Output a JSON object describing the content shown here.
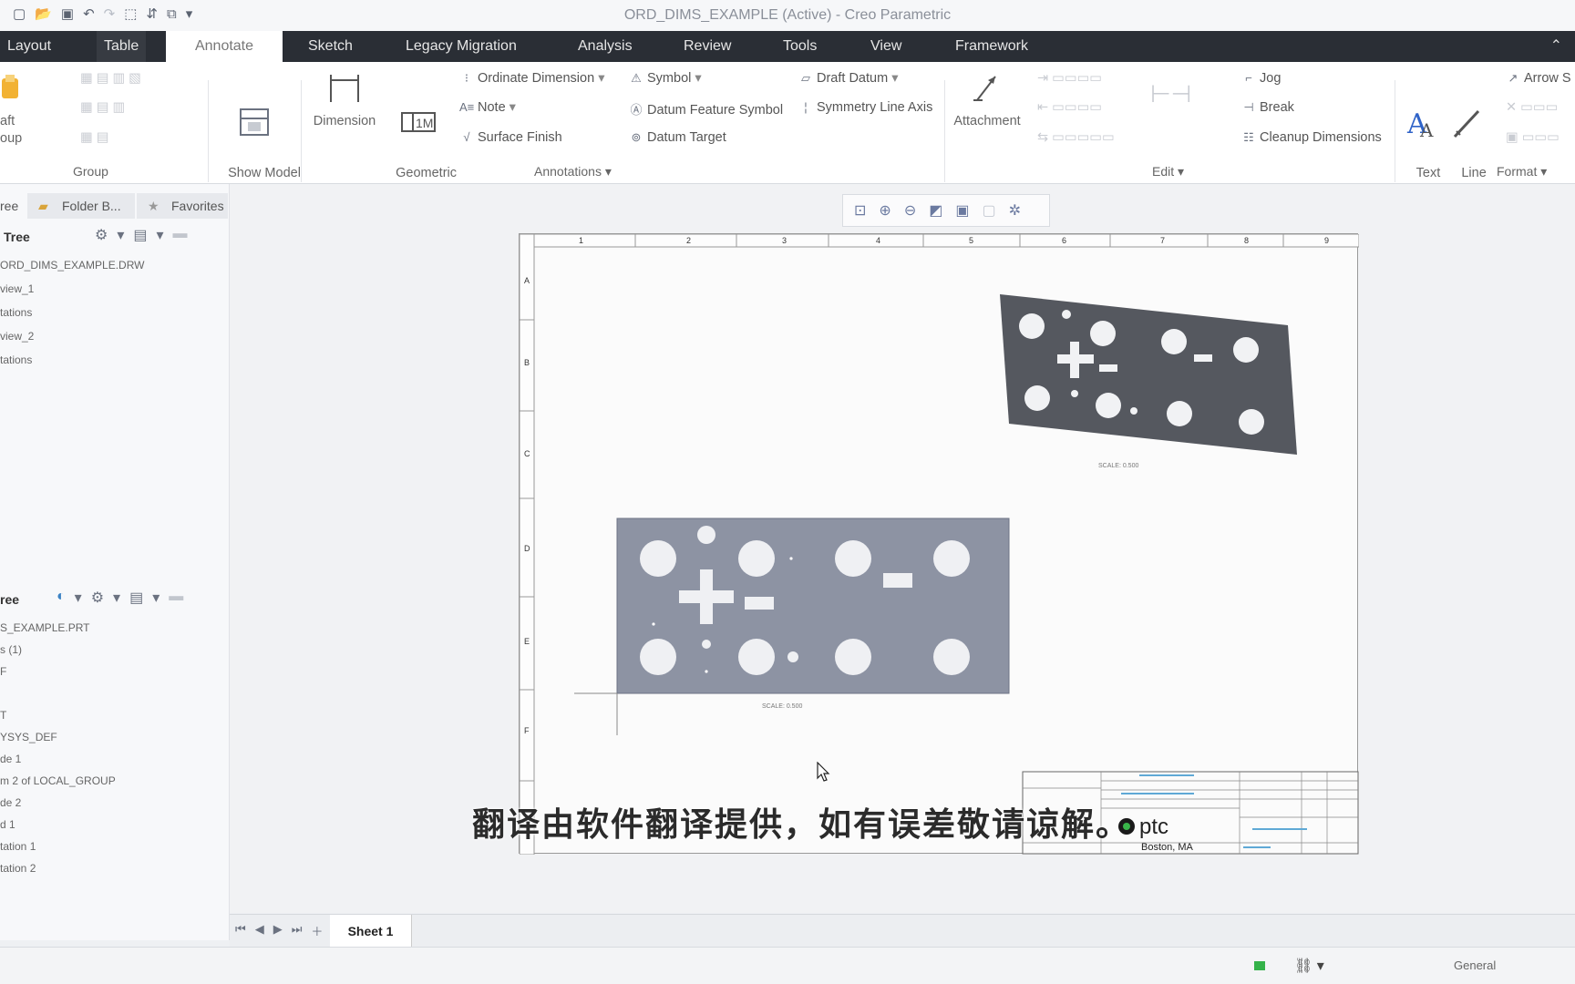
{
  "window": {
    "title": "ORD_DIMS_EXAMPLE (Active) - Creo Parametric"
  },
  "quick_access": {
    "icons": [
      "new-icon",
      "open-icon",
      "save-icon",
      "undo-icon",
      "redo-icon",
      "window-icon",
      "regenerate-icon",
      "close-window-icon",
      "customize-icon"
    ]
  },
  "tabs": [
    "Layout",
    "Table",
    "Annotate",
    "Sketch",
    "Legacy Migration",
    "Analysis",
    "Review",
    "Tools",
    "View",
    "Framework"
  ],
  "active_tab": "Annotate",
  "ribbon": {
    "group_panel": {
      "draft_group_label": "aft\noup",
      "label": "Group"
    },
    "show_model_annotations": "Show Model\nAnnotations",
    "dimension": "Dimension",
    "geometric_tolerance": "Geometric\nTolerance",
    "ordinate_dimension": "Ordinate Dimension",
    "note": "Note",
    "surface_finish": "Surface Finish",
    "symbol": "Symbol",
    "datum_feature_symbol": "Datum Feature Symbol",
    "datum_target": "Datum Target",
    "draft_datum": "Draft Datum",
    "symmetry_line_axis": "Symmetry Line Axis",
    "annotations_label": "Annotations",
    "attachment": "Attachment",
    "jog": "Jog",
    "break": "Break",
    "cleanup_dimensions": "Cleanup Dimensions",
    "edit_label": "Edit",
    "text_style": "Text\nStyle",
    "line_style": "Line\nStyle",
    "arrow_style": "Arrow S",
    "format_label": "Format"
  },
  "left_panel": {
    "tabs": {
      "tree": "ree",
      "folder_browser": "Folder B...",
      "favorites": "Favorites"
    },
    "drawing_tree": {
      "title": "Tree",
      "items": [
        "ORD_DIMS_EXAMPLE.DRW",
        "view_1",
        "tations",
        "view_2",
        "tations"
      ]
    },
    "model_tree": {
      "title": "ree",
      "items": [
        "S_EXAMPLE.PRT",
        "s (1)",
        "F",
        "",
        "T",
        "YSYS_DEF",
        "de 1",
        "m 2 of LOCAL_GROUP",
        "de 2",
        "d 1",
        "tation 1",
        "tation 2"
      ]
    }
  },
  "graphics_toolbar": {
    "icons": [
      "refit-icon",
      "zoom-in-icon",
      "zoom-out-icon",
      "repaint-icon",
      "display-style-icon",
      "datum-display-icon",
      "annotation-display-icon"
    ]
  },
  "drawing": {
    "column_labels": [
      "1",
      "2",
      "3",
      "4",
      "5",
      "6",
      "7",
      "8",
      "9"
    ],
    "row_labels": [
      "A",
      "B",
      "C",
      "D",
      "E",
      "F"
    ],
    "view1_scale": "SCALE: 0.500",
    "view2_scale": "SCALE: 0.500",
    "title_block_company": "ptc",
    "title_block_location": "Boston, MA"
  },
  "sheet_bar": {
    "sheet_tab": "Sheet 1"
  },
  "status_bar": {
    "filter": "General"
  },
  "subtitle": "翻译由软件翻译提供，如有误差敬请谅解。",
  "colors": {
    "tab_bar": "#2a2e35",
    "part_dark": "#55585f",
    "part_light": "#8d93a3",
    "status_green": "#34b24a"
  }
}
